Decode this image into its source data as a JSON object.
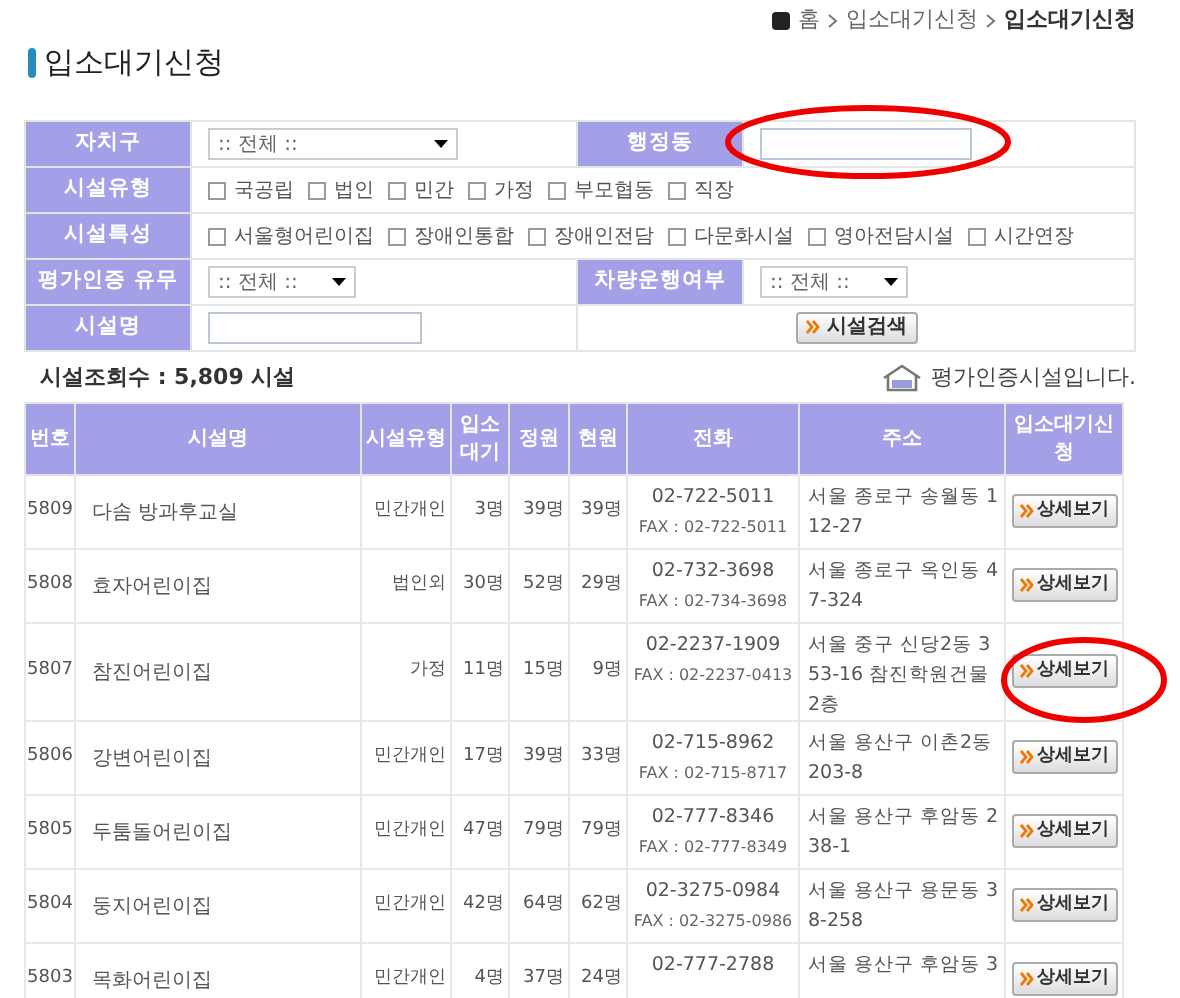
{
  "breadcrumb": {
    "home": "홈",
    "items": [
      {
        "label": "입소대기신청",
        "current": false
      },
      {
        "label": "입소대기신청",
        "current": true
      }
    ]
  },
  "page_title": "입소대기신청",
  "search_form": {
    "district": {
      "label": "자치구",
      "value": ":: 전체 ::"
    },
    "dong": {
      "label": "행정동"
    },
    "facility_type": {
      "label": "시설유형",
      "options": [
        {
          "label": "국공립",
          "checked": false
        },
        {
          "label": "법인",
          "checked": false
        },
        {
          "label": "민간",
          "checked": false
        },
        {
          "label": "가정",
          "checked": false
        },
        {
          "label": "부모협동",
          "checked": false
        },
        {
          "label": "직장",
          "checked": false
        }
      ]
    },
    "facility_feature": {
      "label": "시설특성",
      "options": [
        {
          "label": "서울형어린이집",
          "checked": false
        },
        {
          "label": "장애인통합",
          "checked": false
        },
        {
          "label": "장애인전담",
          "checked": false
        },
        {
          "label": "다문화시설",
          "checked": false
        },
        {
          "label": "영아전담시설",
          "checked": false
        },
        {
          "label": "시간연장",
          "checked": false
        }
      ]
    },
    "accreditation": {
      "label": "평가인증 유무",
      "value": ":: 전체 ::"
    },
    "vehicle": {
      "label": "차량운행여부",
      "value": ":: 전체 ::"
    },
    "name": {
      "label": "시설명"
    },
    "search_button": "시설검색"
  },
  "result_count": "시설조회수 : 5,809 시설",
  "legend": "평가인증시설입니다.",
  "table": {
    "columns": [
      "번호",
      "시설명",
      "시설유형",
      "입소대기",
      "정원",
      "현원",
      "전화",
      "주소",
      "입소대기신청"
    ],
    "rows": [
      {
        "no": "5809",
        "name": "다솜 방과후교실",
        "type": "민간개인",
        "waiting": "3명",
        "capacity": "39명",
        "current": "39명",
        "phone": "02-722-5011",
        "fax": "FAX : 02-722-5011",
        "address": "서울 종로구 송월동 112-27",
        "button": "상세보기"
      },
      {
        "no": "5808",
        "name": "효자어린이집",
        "type": "법인외",
        "waiting": "30명",
        "capacity": "52명",
        "current": "29명",
        "phone": "02-732-3698",
        "fax": "FAX : 02-734-3698",
        "address": "서울 종로구 옥인동 47-324",
        "button": "상세보기"
      },
      {
        "no": "5807",
        "name": "참진어린이집",
        "type": "가정",
        "waiting": "11명",
        "capacity": "15명",
        "current": "9명",
        "phone": "02-2237-1909",
        "fax": "FAX : 02-2237-0413",
        "address": "서울 중구 신당2동 353-16 참진학원건물 2층",
        "button": "상세보기"
      },
      {
        "no": "5806",
        "name": "강변어린이집",
        "type": "민간개인",
        "waiting": "17명",
        "capacity": "39명",
        "current": "33명",
        "phone": "02-715-8962",
        "fax": "FAX : 02-715-8717",
        "address": "서울 용산구 이촌2동 203-8",
        "button": "상세보기"
      },
      {
        "no": "5805",
        "name": "두툼돌어린이집",
        "type": "민간개인",
        "waiting": "47명",
        "capacity": "79명",
        "current": "79명",
        "phone": "02-777-8346",
        "fax": "FAX : 02-777-8349",
        "address": "서울 용산구 후암동 238-1",
        "button": "상세보기"
      },
      {
        "no": "5804",
        "name": "둥지어린이집",
        "type": "민간개인",
        "waiting": "42명",
        "capacity": "64명",
        "current": "62명",
        "phone": "02-3275-0984",
        "fax": "FAX : 02-3275-0986",
        "address": "서울 용산구 용문동 38-258",
        "button": "상세보기"
      },
      {
        "no": "5803",
        "name": "목화어린이집",
        "type": "민간개인",
        "waiting": "4명",
        "capacity": "37명",
        "current": "24명",
        "phone": "02-777-2788",
        "address": "서울 용산구 후암동 3",
        "button": "상세보기"
      }
    ]
  }
}
